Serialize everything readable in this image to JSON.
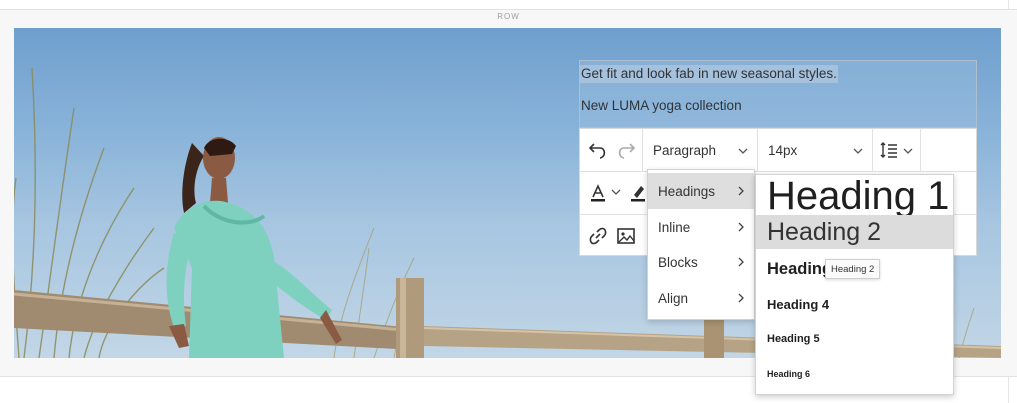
{
  "row": {
    "label": "ROW"
  },
  "editor": {
    "line1": "Get fit and look fab in new seasonal styles.",
    "line2": "New LUMA yoga collection"
  },
  "toolbar": {
    "format_value": "Paragraph",
    "font_size_value": "14px",
    "icons": [
      "undo-icon",
      "redo-icon",
      "line-height-icon",
      "text-color-icon",
      "highlight-icon",
      "link-icon",
      "image-icon"
    ]
  },
  "format_menu": {
    "items": [
      {
        "label": "Headings",
        "active": true
      },
      {
        "label": "Inline",
        "active": false
      },
      {
        "label": "Blocks",
        "active": false
      },
      {
        "label": "Align",
        "active": false
      }
    ]
  },
  "headings_submenu": {
    "items": [
      "Heading 1",
      "Heading 2",
      "Heading",
      "Heading 4",
      "Heading 5",
      "Heading 6"
    ],
    "highlighted": "Heading 2"
  },
  "tooltip": {
    "text": "Heading 2"
  },
  "colors": {
    "accent_selection": "#a6c1dc",
    "menu_active": "#dedede"
  }
}
